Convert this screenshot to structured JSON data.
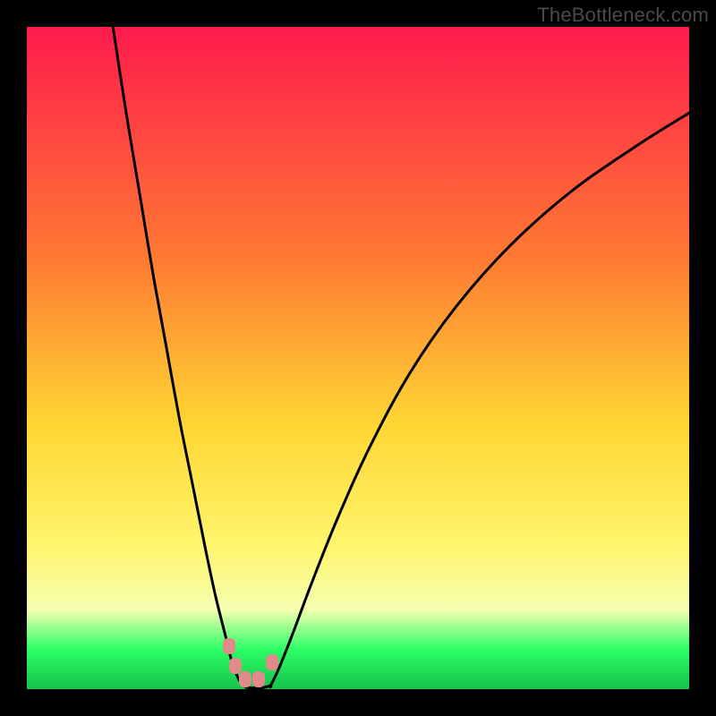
{
  "watermark": "TheBottleneck.com",
  "colors": {
    "frame": "#000000",
    "top": "#ff1a4d",
    "mid_upper": "#ff7a33",
    "mid": "#ffd633",
    "lower_yellow": "#fff56b",
    "pale": "#f6ffb0",
    "green": "#2bff66",
    "green_dark": "#16c24a",
    "curve": "#000000",
    "marker": "#e08a8a"
  },
  "chart_data": {
    "type": "line",
    "title": "",
    "xlabel": "",
    "ylabel": "",
    "xlim": [
      0,
      100
    ],
    "ylim": [
      0,
      100
    ],
    "series": [
      {
        "name": "left-branch",
        "x": [
          13,
          15,
          17,
          19,
          21,
          23,
          25,
          27,
          28.5,
          30,
          31,
          32,
          32.8
        ],
        "y": [
          100,
          87,
          75,
          63,
          52,
          41,
          31,
          21,
          14,
          8,
          4,
          1.5,
          0.5
        ]
      },
      {
        "name": "right-branch",
        "x": [
          36.8,
          38,
          40,
          43,
          47,
          52,
          58,
          65,
          73,
          82,
          92,
          100
        ],
        "y": [
          0.5,
          3,
          8,
          16,
          26,
          37,
          48,
          58,
          67,
          75,
          82,
          87
        ]
      },
      {
        "name": "valley-floor",
        "x": [
          32.8,
          33.5,
          34.5,
          35.5,
          36.8
        ],
        "y": [
          0.5,
          0.2,
          0.2,
          0.2,
          0.5
        ]
      }
    ],
    "markers": [
      {
        "x": 30.5,
        "y": 6.5
      },
      {
        "x": 31.5,
        "y": 3.5
      },
      {
        "x": 33.0,
        "y": 1.5
      },
      {
        "x": 35.0,
        "y": 1.5
      },
      {
        "x": 37.0,
        "y": 4.0
      }
    ],
    "gradient_stops_pct": [
      {
        "pct": 0,
        "color": "top"
      },
      {
        "pct": 35,
        "color": "mid_upper"
      },
      {
        "pct": 60,
        "color": "mid"
      },
      {
        "pct": 78,
        "color": "lower_yellow"
      },
      {
        "pct": 88,
        "color": "pale"
      },
      {
        "pct": 94,
        "color": "green"
      },
      {
        "pct": 100,
        "color": "green_dark"
      }
    ]
  }
}
